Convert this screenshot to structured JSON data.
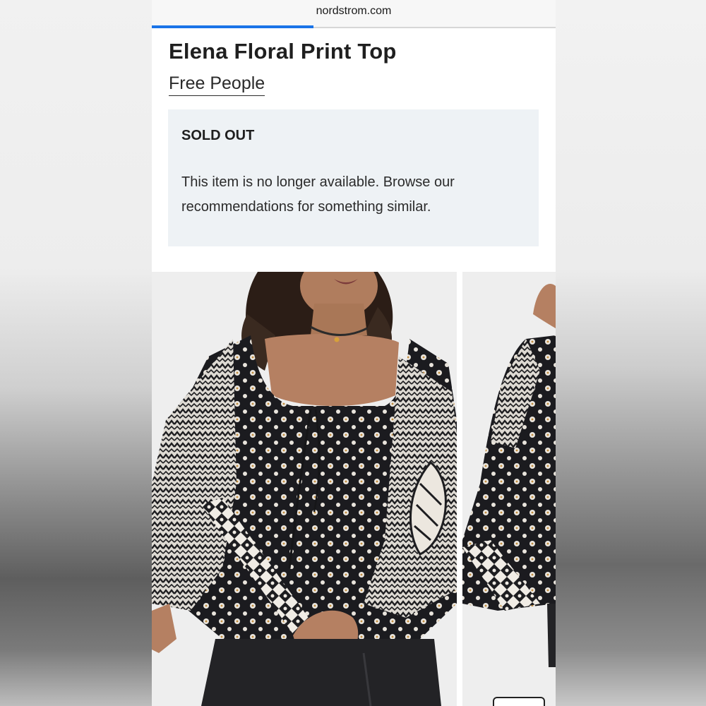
{
  "browser": {
    "url": "nordstrom.com",
    "load_progress": 0.4
  },
  "product": {
    "title": "Elena Floral Print Top",
    "brand": "Free People"
  },
  "notice": {
    "heading": "SOLD OUT",
    "message": "This item is no longer available. Browse our recommendations for something similar."
  },
  "gallery": {
    "images": [
      {
        "alt": "model-front-view"
      },
      {
        "alt": "model-side-view"
      }
    ]
  },
  "colors": {
    "progress": "#1a73e8",
    "notice_bg": "#eef2f5",
    "text": "#1f1f1f"
  }
}
